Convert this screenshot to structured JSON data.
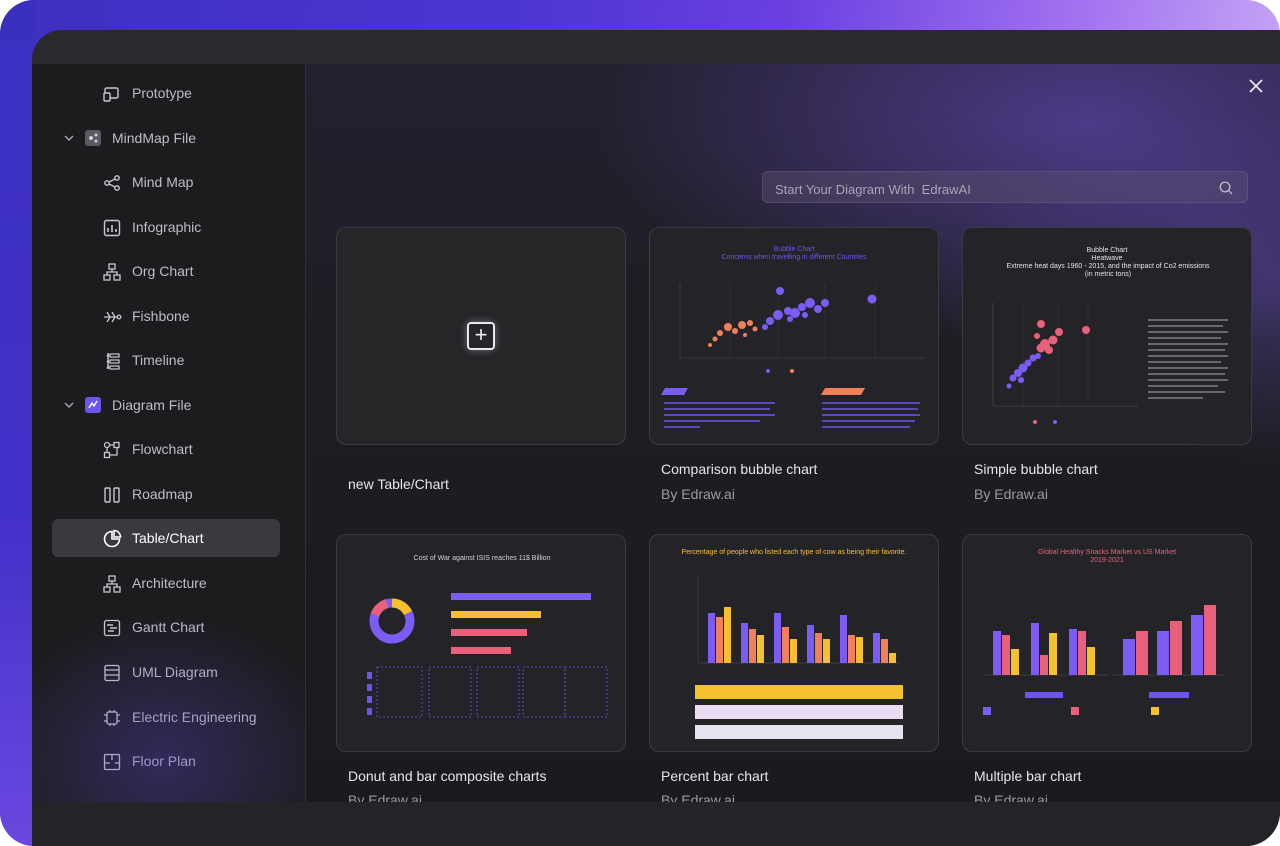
{
  "sidebar": {
    "items": [
      {
        "label": "Prototype",
        "icon": "prototype-icon"
      },
      {
        "label": "MindMap File",
        "icon": "mindmap-file-icon",
        "group": true
      },
      {
        "label": "Mind Map",
        "icon": "mind-map-icon"
      },
      {
        "label": "Infographic",
        "icon": "infographic-icon"
      },
      {
        "label": "Org Chart",
        "icon": "org-chart-icon"
      },
      {
        "label": "Fishbone",
        "icon": "fishbone-icon"
      },
      {
        "label": "Timeline",
        "icon": "timeline-icon"
      },
      {
        "label": "Diagram File",
        "icon": "diagram-file-icon",
        "group": true
      },
      {
        "label": "Flowchart",
        "icon": "flowchart-icon"
      },
      {
        "label": "Roadmap",
        "icon": "roadmap-icon"
      },
      {
        "label": "Table/Chart",
        "icon": "table-chart-icon",
        "active": true
      },
      {
        "label": "Architecture",
        "icon": "architecture-icon"
      },
      {
        "label": "Gantt Chart",
        "icon": "gantt-chart-icon"
      },
      {
        "label": "UML Diagram",
        "icon": "uml-diagram-icon"
      },
      {
        "label": "Electric Engineering",
        "icon": "electric-engineering-icon"
      },
      {
        "label": "Floor Plan",
        "icon": "floor-plan-icon"
      }
    ]
  },
  "search": {
    "placeholder": "Start Your Diagram With  EdrawAI"
  },
  "cards": [
    {
      "title": "new Table/Chart",
      "author": ""
    },
    {
      "title": "Comparison bubble chart",
      "author": "By Edraw.ai",
      "thumb_title": "Bubble Chart",
      "thumb_subtitle": "Concerns when travelling in different Countries"
    },
    {
      "title": "Simple bubble chart",
      "author": "By Edraw.ai",
      "thumb_title": "Bubble Chart",
      "thumb_subtitle": "Heatwave",
      "thumb_subtitle2": "Extreme heat days 1960 - 2015, and the impact of Co2 emissions (in metric tons)"
    },
    {
      "title": "Donut and bar composite charts",
      "author": "By Edraw.ai",
      "thumb_title": "Cost of War against ISIS reaches 11$ Billion"
    },
    {
      "title": "Percent bar chart",
      "author": "By Edraw.ai",
      "thumb_title": "Percentage of people who listed each type of cow as being their favorite."
    },
    {
      "title": "Multiple bar chart",
      "author": "By Edraw.ai",
      "thumb_title": "Global Healthy Snacks Market vs US Market",
      "thumb_subtitle": "2019-2021"
    }
  ],
  "colors": {
    "accent": "#6b54f0",
    "active_bg": "#3a393f",
    "purple": "#7b5cf5",
    "orange": "#f0805a",
    "yellow": "#f5c030",
    "pink": "#e8607a"
  }
}
